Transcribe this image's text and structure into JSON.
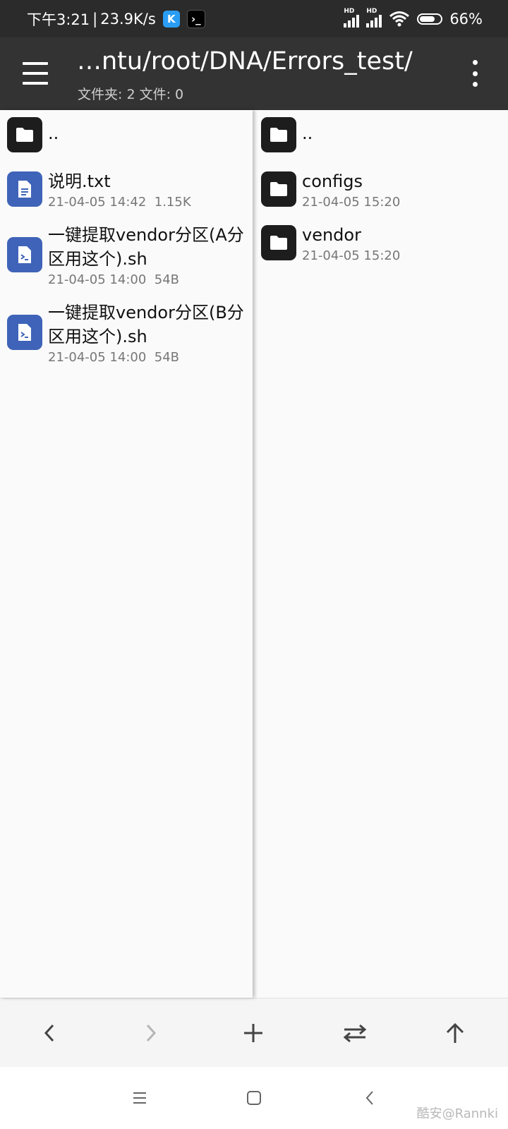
{
  "status_bar": {
    "time": "下午3:21",
    "separator": "|",
    "net_speed": "23.9K/s",
    "app_badge_1": "K",
    "app_badge_2": "›_",
    "hd_1": "HD",
    "hd_2": "HD",
    "battery": "66%"
  },
  "app_bar": {
    "path": "…ntu/root/DNA/Errors_test/",
    "subtitle": "文件夹: 2  文件: 0"
  },
  "left_pane": {
    "items": [
      {
        "name": "..",
        "meta": "",
        "type": "folder"
      },
      {
        "name": "说明.txt",
        "meta": "21-04-05 14:42  1.15K",
        "type": "text"
      },
      {
        "name": "一键提取vendor分区(A分区用这个).sh",
        "meta": "21-04-05 14:00  54B",
        "type": "script"
      },
      {
        "name": "一键提取vendor分区(B分区用这个).sh",
        "meta": "21-04-05 14:00  54B",
        "type": "script"
      }
    ]
  },
  "right_pane": {
    "items": [
      {
        "name": "..",
        "meta": "",
        "type": "folder"
      },
      {
        "name": "configs",
        "meta": "21-04-05 15:20",
        "type": "folder"
      },
      {
        "name": "vendor",
        "meta": "21-04-05 15:20",
        "type": "folder"
      }
    ]
  },
  "toolbar": {
    "icons": [
      "back-icon",
      "forward-icon",
      "add-icon",
      "swap-icon",
      "up-icon"
    ]
  },
  "nav_bar": {
    "icons": [
      "menu-icon",
      "home-icon",
      "back-icon"
    ]
  },
  "watermark": "酷安@Rannki",
  "colors": {
    "app_bar": "#333333",
    "status_bar": "#2b2b2b",
    "folder_icon": "#1d1d1d",
    "file_icon": "#3f63b8"
  }
}
